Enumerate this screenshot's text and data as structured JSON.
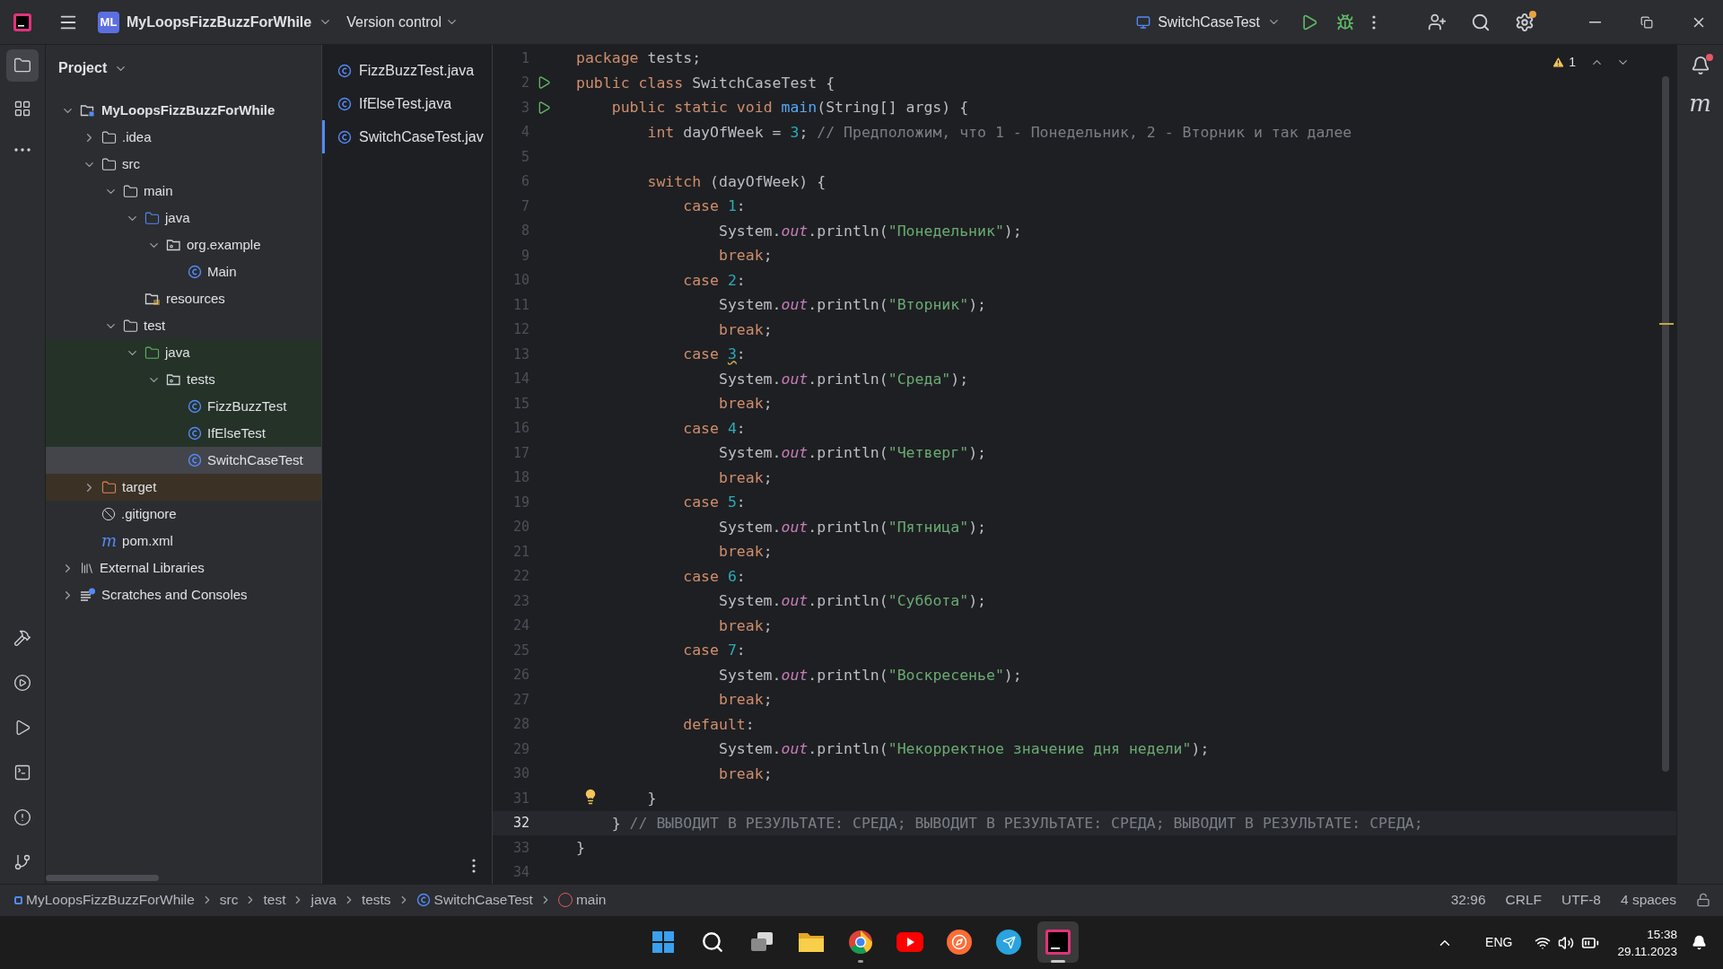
{
  "title_bar": {
    "project_badge": "ML",
    "project_name": "MyLoopsFizzBuzzForWhile",
    "vcs_label": "Version control",
    "run_config": "SwitchCaseTest",
    "settings_update": true
  },
  "tool_strip": {
    "top": [
      {
        "kind": "project",
        "selected": true
      },
      {
        "kind": "structure",
        "selected": false
      },
      {
        "kind": "more",
        "selected": false
      }
    ],
    "bottom": [
      {
        "kind": "build",
        "selected": false
      },
      {
        "kind": "services",
        "selected": false
      },
      {
        "kind": "run",
        "selected": false
      },
      {
        "kind": "terminal",
        "selected": false
      },
      {
        "kind": "problems",
        "selected": false
      },
      {
        "kind": "git",
        "selected": false
      }
    ]
  },
  "project_panel": {
    "title": "Project",
    "tree": [
      {
        "label": "MyLoopsFizzBuzzForWhile",
        "kind": "module",
        "expanded": true,
        "selected": false,
        "children": [
          {
            "label": ".idea",
            "kind": "folder",
            "expanded": false,
            "selected": false
          },
          {
            "label": "src",
            "kind": "folder",
            "expanded": true,
            "selected": false,
            "children": [
              {
                "label": "main",
                "kind": "folder",
                "expanded": true,
                "selected": false,
                "children": [
                  {
                    "label": "java",
                    "kind": "source-folder",
                    "expanded": true,
                    "selected": false,
                    "children": [
                      {
                        "label": "org.example",
                        "kind": "package",
                        "expanded": true,
                        "selected": false,
                        "children": [
                          {
                            "label": "Main",
                            "kind": "class",
                            "selected": false
                          }
                        ]
                      }
                    ]
                  },
                  {
                    "label": "resources",
                    "kind": "resources",
                    "selected": false
                  }
                ]
              },
              {
                "label": "test",
                "kind": "folder",
                "expanded": true,
                "selected": false,
                "children": [
                  {
                    "label": "java",
                    "kind": "test-folder",
                    "expanded": true,
                    "selected": false,
                    "color": "#253228",
                    "children": [
                      {
                        "label": "tests",
                        "kind": "package",
                        "expanded": true,
                        "selected": false,
                        "color": "#253228",
                        "children": [
                          {
                            "label": "FizzBuzzTest",
                            "kind": "class",
                            "selected": false,
                            "color": "#253228"
                          },
                          {
                            "label": "IfElseTest",
                            "kind": "class",
                            "selected": false,
                            "color": "#253228"
                          },
                          {
                            "label": "SwitchCaseTest",
                            "kind": "class",
                            "selected": true
                          }
                        ]
                      }
                    ]
                  }
                ]
              }
            ]
          },
          {
            "label": "target",
            "kind": "excluded-folder",
            "expanded": false,
            "selected": false,
            "color": "#3b3125"
          },
          {
            "label": ".gitignore",
            "kind": "ignore",
            "selected": false
          },
          {
            "label": "pom.xml",
            "kind": "maven",
            "icon_text": "m",
            "selected": false
          }
        ]
      },
      {
        "label": "External Libraries",
        "kind": "library",
        "expanded": false,
        "selected": false
      },
      {
        "label": "Scratches and Consoles",
        "kind": "scratches",
        "expanded": false,
        "selected": false
      }
    ]
  },
  "open_files": [
    {
      "label": "FizzBuzzTest.java",
      "selected": false
    },
    {
      "label": "IfElseTest.java",
      "selected": false
    },
    {
      "label": "SwitchCaseTest.jav",
      "selected": true
    }
  ],
  "editor": {
    "warnings": "1",
    "lines": [
      {
        "number": "1",
        "selected": false,
        "tokens": [
          {
            "kind": "keyword",
            "text": "package"
          },
          {
            "kind": "plain",
            "text": " tests;"
          }
        ]
      },
      {
        "number": "2",
        "selected": false,
        "run": true,
        "tokens": [
          {
            "kind": "keyword",
            "text": "public class"
          },
          {
            "kind": "plain",
            "text": " SwitchCaseTest {"
          }
        ]
      },
      {
        "number": "3",
        "selected": false,
        "run": true,
        "tokens": [
          {
            "kind": "keyword",
            "text": "    public static void"
          },
          {
            "kind": "method",
            "text": " main"
          },
          {
            "kind": "plain",
            "text": "(String[] args) {"
          }
        ]
      },
      {
        "number": "4",
        "selected": false,
        "tokens": [
          {
            "kind": "keyword",
            "text": "        int"
          },
          {
            "kind": "plain",
            "text": " dayOfWeek = "
          },
          {
            "kind": "number",
            "text": "3"
          },
          {
            "kind": "plain",
            "text": ";"
          },
          {
            "kind": "comment",
            "text": " // Предположим, что 1 - Понедельник, 2 - Вторник и так далее"
          }
        ]
      },
      {
        "number": "5",
        "selected": false
      },
      {
        "number": "6",
        "selected": false,
        "tokens": [
          {
            "kind": "keyword",
            "text": "        switch"
          },
          {
            "kind": "plain",
            "text": " (dayOfWeek) {"
          }
        ]
      },
      {
        "number": "7",
        "selected": false,
        "tokens": [
          {
            "kind": "keyword",
            "text": "            case"
          },
          {
            "kind": "number",
            "text": " 1"
          },
          {
            "kind": "plain",
            "text": ":"
          }
        ]
      },
      {
        "number": "8",
        "selected": false,
        "tokens": [
          {
            "kind": "plain",
            "text": "                System."
          },
          {
            "kind": "field",
            "text": "out"
          },
          {
            "kind": "plain",
            "text": ".println("
          },
          {
            "kind": "string",
            "text": "\"Понедельник\""
          },
          {
            "kind": "plain",
            "text": ");"
          }
        ]
      },
      {
        "number": "9",
        "selected": false,
        "tokens": [
          {
            "kind": "keyword",
            "text": "                break"
          },
          {
            "kind": "plain",
            "text": ";"
          }
        ]
      },
      {
        "number": "10",
        "selected": false,
        "tokens": [
          {
            "kind": "keyword",
            "text": "            case"
          },
          {
            "kind": "number",
            "text": " 2"
          },
          {
            "kind": "plain",
            "text": ":"
          }
        ]
      },
      {
        "number": "11",
        "selected": false,
        "tokens": [
          {
            "kind": "plain",
            "text": "                System."
          },
          {
            "kind": "field",
            "text": "out"
          },
          {
            "kind": "plain",
            "text": ".println("
          },
          {
            "kind": "string",
            "text": "\"Вторник\""
          },
          {
            "kind": "plain",
            "text": ");"
          }
        ]
      },
      {
        "number": "12",
        "selected": false,
        "tokens": [
          {
            "kind": "keyword",
            "text": "                break"
          },
          {
            "kind": "plain",
            "text": ";"
          }
        ]
      },
      {
        "number": "13",
        "selected": false,
        "tokens": [
          {
            "kind": "keyword",
            "text": "            case "
          },
          {
            "kind": "flagged",
            "text": "3"
          },
          {
            "kind": "plain",
            "text": ":"
          }
        ]
      },
      {
        "number": "14",
        "selected": false,
        "tokens": [
          {
            "kind": "plain",
            "text": "                System."
          },
          {
            "kind": "field",
            "text": "out"
          },
          {
            "kind": "plain",
            "text": ".println("
          },
          {
            "kind": "string",
            "text": "\"Среда\""
          },
          {
            "kind": "plain",
            "text": ");"
          }
        ]
      },
      {
        "number": "15",
        "selected": false,
        "tokens": [
          {
            "kind": "keyword",
            "text": "                break"
          },
          {
            "kind": "plain",
            "text": ";"
          }
        ]
      },
      {
        "number": "16",
        "selected": false,
        "tokens": [
          {
            "kind": "keyword",
            "text": "            case"
          },
          {
            "kind": "number",
            "text": " 4"
          },
          {
            "kind": "plain",
            "text": ":"
          }
        ]
      },
      {
        "number": "17",
        "selected": false,
        "tokens": [
          {
            "kind": "plain",
            "text": "                System."
          },
          {
            "kind": "field",
            "text": "out"
          },
          {
            "kind": "plain",
            "text": ".println("
          },
          {
            "kind": "string",
            "text": "\"Четверг\""
          },
          {
            "kind": "plain",
            "text": ");"
          }
        ]
      },
      {
        "number": "18",
        "selected": false,
        "tokens": [
          {
            "kind": "keyword",
            "text": "                break"
          },
          {
            "kind": "plain",
            "text": ";"
          }
        ]
      },
      {
        "number": "19",
        "selected": false,
        "tokens": [
          {
            "kind": "keyword",
            "text": "            case"
          },
          {
            "kind": "number",
            "text": " 5"
          },
          {
            "kind": "plain",
            "text": ":"
          }
        ]
      },
      {
        "number": "20",
        "selected": false,
        "tokens": [
          {
            "kind": "plain",
            "text": "                System."
          },
          {
            "kind": "field",
            "text": "out"
          },
          {
            "kind": "plain",
            "text": ".println("
          },
          {
            "kind": "string",
            "text": "\"Пятница\""
          },
          {
            "kind": "plain",
            "text": ");"
          }
        ]
      },
      {
        "number": "21",
        "selected": false,
        "tokens": [
          {
            "kind": "keyword",
            "text": "                break"
          },
          {
            "kind": "plain",
            "text": ";"
          }
        ]
      },
      {
        "number": "22",
        "selected": false,
        "tokens": [
          {
            "kind": "keyword",
            "text": "            case"
          },
          {
            "kind": "number",
            "text": " 6"
          },
          {
            "kind": "plain",
            "text": ":"
          }
        ]
      },
      {
        "number": "23",
        "selected": false,
        "tokens": [
          {
            "kind": "plain",
            "text": "                System."
          },
          {
            "kind": "field",
            "text": "out"
          },
          {
            "kind": "plain",
            "text": ".println("
          },
          {
            "kind": "string",
            "text": "\"Суббота\""
          },
          {
            "kind": "plain",
            "text": ");"
          }
        ]
      },
      {
        "number": "24",
        "selected": false,
        "tokens": [
          {
            "kind": "keyword",
            "text": "                break"
          },
          {
            "kind": "plain",
            "text": ";"
          }
        ]
      },
      {
        "number": "25",
        "selected": false,
        "tokens": [
          {
            "kind": "keyword",
            "text": "            case"
          },
          {
            "kind": "number",
            "text": " 7"
          },
          {
            "kind": "plain",
            "text": ":"
          }
        ]
      },
      {
        "number": "26",
        "selected": false,
        "tokens": [
          {
            "kind": "plain",
            "text": "                System."
          },
          {
            "kind": "field",
            "text": "out"
          },
          {
            "kind": "plain",
            "text": ".println("
          },
          {
            "kind": "string",
            "text": "\"Воскресенье\""
          },
          {
            "kind": "plain",
            "text": ");"
          }
        ]
      },
      {
        "number": "27",
        "selected": false,
        "tokens": [
          {
            "kind": "keyword",
            "text": "                break"
          },
          {
            "kind": "plain",
            "text": ";"
          }
        ]
      },
      {
        "number": "28",
        "selected": false,
        "tokens": [
          {
            "kind": "keyword",
            "text": "            default"
          },
          {
            "kind": "plain",
            "text": ":"
          }
        ]
      },
      {
        "number": "29",
        "selected": false,
        "tokens": [
          {
            "kind": "plain",
            "text": "                System."
          },
          {
            "kind": "field",
            "text": "out"
          },
          {
            "kind": "plain",
            "text": ".println("
          },
          {
            "kind": "string",
            "text": "\"Некорректное значение дня недели\""
          },
          {
            "kind": "plain",
            "text": ");"
          }
        ]
      },
      {
        "number": "30",
        "selected": false,
        "tokens": [
          {
            "kind": "keyword",
            "text": "                break"
          },
          {
            "kind": "plain",
            "text": ";"
          }
        ]
      },
      {
        "number": "31",
        "selected": false,
        "hint": true,
        "tokens": [
          {
            "kind": "plain",
            "text": "        }"
          }
        ]
      },
      {
        "number": "32",
        "selected": true,
        "tokens": [
          {
            "kind": "plain",
            "text": "    }"
          },
          {
            "kind": "comment",
            "text": " // ВЫВОДИТ В РЕЗУЛЬТАТЕ: СРЕДА; ВЫВОДИТ В РЕЗУЛЬТАТЕ: СРЕДА; ВЫВОДИТ В РЕЗУЛЬТАТЕ: СРЕДА;"
          }
        ]
      },
      {
        "number": "33",
        "selected": false,
        "tokens": [
          {
            "kind": "plain",
            "text": "}"
          }
        ]
      },
      {
        "number": "34",
        "selected": false
      }
    ]
  },
  "right_strip": {
    "notifications_unread": true,
    "maven_label": "m"
  },
  "status_bar": {
    "breadcrumbs": [
      {
        "label": "MyLoopsFizzBuzzForWhile",
        "kind": "module"
      },
      {
        "label": "src",
        "kind": "folder"
      },
      {
        "label": "test",
        "kind": "folder"
      },
      {
        "label": "java",
        "kind": "folder"
      },
      {
        "label": "tests",
        "kind": "folder"
      },
      {
        "label": "SwitchCaseTest",
        "kind": "class"
      },
      {
        "label": "main",
        "kind": "method"
      }
    ],
    "position": "32:96",
    "line_separator": "CRLF",
    "encoding": "UTF-8",
    "indent": "4 spaces"
  },
  "taskbar": {
    "apps": [
      {
        "kind": "start",
        "selected": false
      },
      {
        "kind": "search",
        "selected": false
      },
      {
        "kind": "task-view",
        "selected": false
      },
      {
        "kind": "explorer",
        "selected": false
      },
      {
        "kind": "browser",
        "selected": false,
        "running": true
      },
      {
        "kind": "video",
        "selected": false
      },
      {
        "kind": "compass",
        "selected": false
      },
      {
        "kind": "messenger",
        "selected": false
      },
      {
        "kind": "ide",
        "selected": true,
        "running": true
      }
    ],
    "language": "ENG",
    "time": "15:38",
    "date": "29.11.2023"
  }
}
